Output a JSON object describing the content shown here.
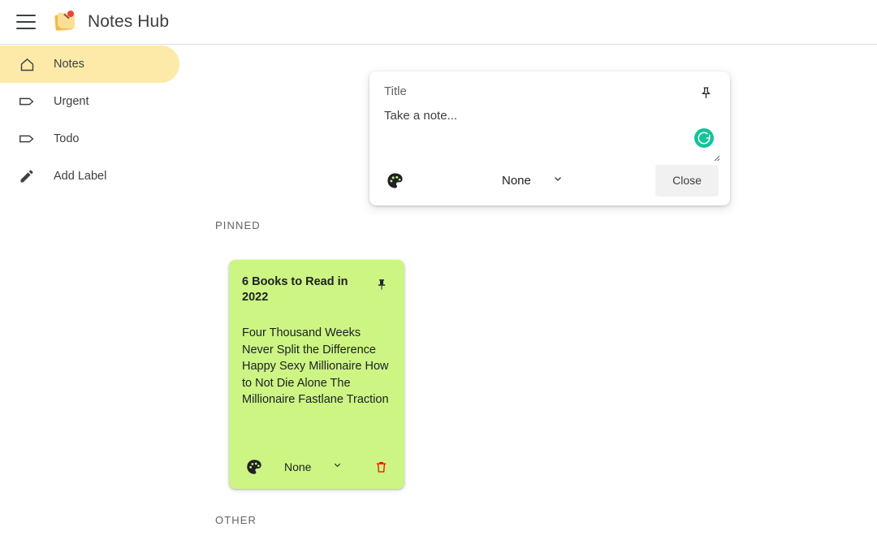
{
  "header": {
    "menu_icon": "hamburger-menu-icon",
    "logo_icon": "pinned-note-emoji",
    "title": "Notes Hub"
  },
  "sidebar": {
    "items": [
      {
        "label": "Notes",
        "icon": "home-icon",
        "active": true
      },
      {
        "label": "Urgent",
        "icon": "label-icon",
        "active": false
      },
      {
        "label": "Todo",
        "icon": "label-icon",
        "active": false
      },
      {
        "label": "Add Label",
        "icon": "pencil-icon",
        "active": false
      }
    ]
  },
  "editor": {
    "title_placeholder": "Title",
    "title_value": "",
    "note_placeholder": "Take a note...",
    "note_value": "",
    "pin_icon": "pin-outline-icon",
    "palette_icon": "color-palette-icon",
    "grammarly_icon": "grammarly-icon",
    "resize_icon": "resize-grip-icon",
    "label_selected": "None",
    "label_options": [
      "None",
      "Urgent",
      "Todo"
    ],
    "close_label": "Close"
  },
  "sections": {
    "pinned": "PINNED",
    "other": "OTHER"
  },
  "notes": [
    {
      "title": "6 Books to Read in 2022",
      "body": "Four Thousand Weeks Never Split the Difference Happy Sexy Millionaire How to Not Die Alone The Millionaire Fastlane Traction",
      "color": "#ccf584",
      "pin_icon": "pin-filled-icon",
      "palette_icon": "color-palette-icon",
      "label_selected": "None",
      "delete_icon": "trash-icon"
    }
  ],
  "colors": {
    "accent_yellow": "#fdeaa8",
    "note_green": "#ccf584",
    "grammarly_green": "#15c39a",
    "delete_red": "#ff0000",
    "close_button_bg": "#f1f1f1"
  }
}
